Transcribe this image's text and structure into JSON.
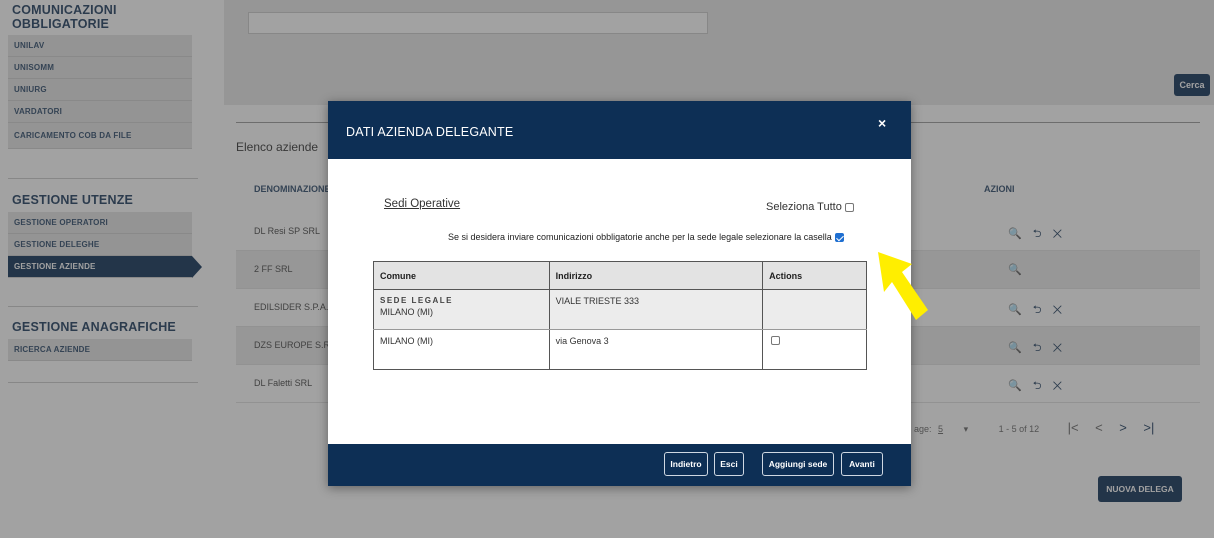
{
  "sidebar": {
    "sections": [
      {
        "title": "COMUNICAZIONI OBBLIGATORIE",
        "items": [
          "UNILAV",
          "UNISOMM",
          "UNIURG",
          "VARDATORI",
          "CARICAMENTO COB DA FILE"
        ]
      },
      {
        "title": "GESTIONE UTENZE",
        "items": [
          "GESTIONE OPERATORI",
          "GESTIONE DELEGHE",
          "GESTIONE AZIENDE"
        ]
      },
      {
        "title": "GESTIONE ANAGRAFICHE",
        "items": [
          "RICERCA AZIENDE"
        ]
      }
    ],
    "active_item": "GESTIONE AZIENDE"
  },
  "main": {
    "search_button": "Cerca",
    "list_title": "Elenco aziende",
    "columns": {
      "denominazione": "DENOMINAZIONE",
      "azioni": "AZIONI"
    },
    "rows": [
      {
        "name": "DL Resi SP SRL",
        "actions": "🔍 ⮌ ✕"
      },
      {
        "name": "2 FF SRL",
        "actions": "🔍"
      },
      {
        "name": "EDILSIDER S.P.A.",
        "actions": "🔍 ⮌ ✕"
      },
      {
        "name": "DZS EUROPE S.R.",
        "actions": "🔍 ⮌ ✕"
      },
      {
        "name": "DL Faletti SRL",
        "actions": "🔍 ⮌ ✕"
      }
    ],
    "pager": {
      "per_page_label": "age:",
      "per_page": "5",
      "range": "1 - 5 of 12"
    },
    "new_button": "NUOVA DELEGA"
  },
  "modal": {
    "title": "DATI AZIENDA DELEGANTE",
    "close": "×",
    "sedi_link": "Sedi Operative",
    "select_all": "Seleziona Tutto",
    "sede_legale_msg": "Se si desidera inviare comunicazioni obbligatorie anche per la sede legale selezionare la casella",
    "sede_legale_checked": true,
    "table": {
      "headers": [
        "Comune",
        "Indirizzo",
        "Actions"
      ],
      "rows": [
        {
          "tag": "SEDE LEGALE",
          "comune": "MILANO (MI)",
          "indirizzo": "VIALE TRIESTE 333"
        },
        {
          "tag": "",
          "comune": "MILANO (MI)",
          "indirizzo": "via Genova 3"
        }
      ]
    },
    "buttons": {
      "indietro": "Indietro",
      "esci": "Esci",
      "aggiungi": "Aggiungi sede",
      "avanti": "Avanti"
    }
  },
  "colors": {
    "primary": "#0d2f55",
    "highlight_arrow": "#ffee00",
    "checkbox": "#1f6fd1"
  }
}
